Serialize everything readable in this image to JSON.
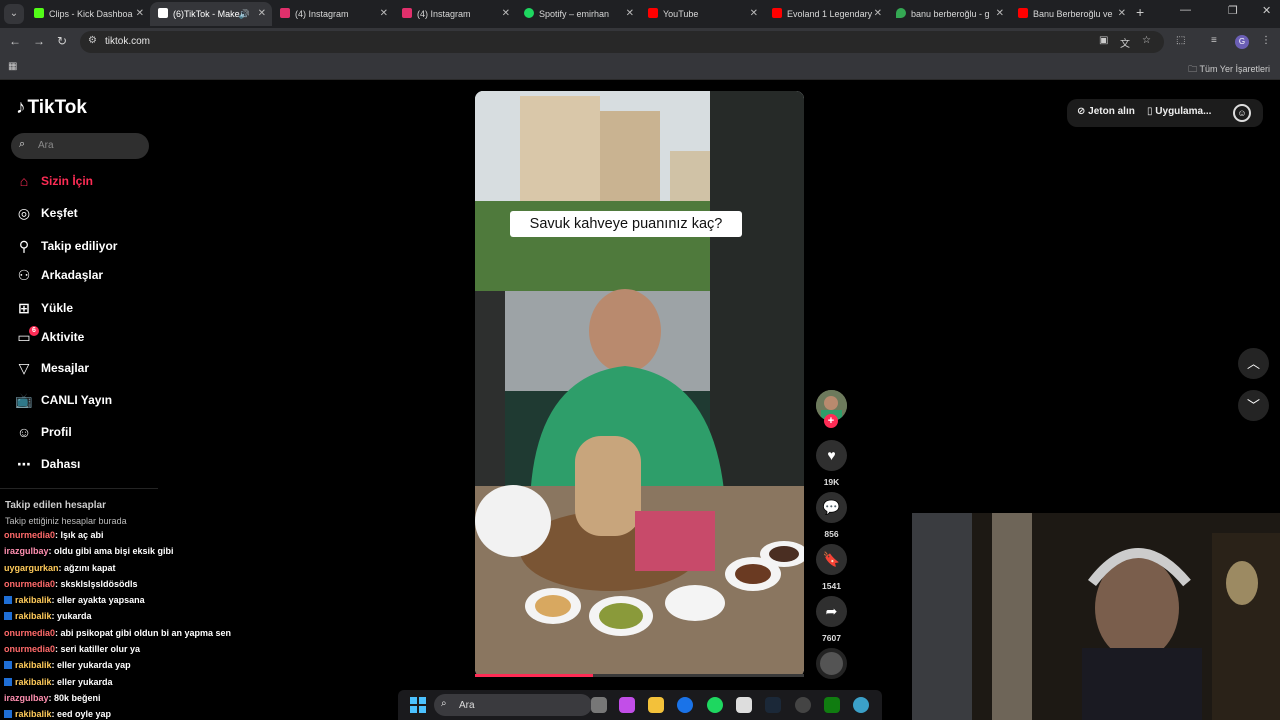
{
  "browser": {
    "tabs": [
      {
        "label": "Clips - Kick Dashboa",
        "color": "#53fc18",
        "active": false
      },
      {
        "label": "(6)TikTok - Make",
        "color": "#ffffff",
        "active": true
      },
      {
        "label": "(4) Instagram",
        "color": "#e1306c",
        "active": false
      },
      {
        "label": "(4) Instagram",
        "color": "#e1306c",
        "active": false
      },
      {
        "label": "Spotify – emirhan",
        "color": "#1ed760",
        "active": false
      },
      {
        "label": "YouTube",
        "color": "#ff0000",
        "active": false
      },
      {
        "label": "Evoland 1 Legendary",
        "color": "#ff0000",
        "active": false
      },
      {
        "label": "banu berberoğlu - g",
        "color": "#34a853",
        "active": false
      },
      {
        "label": "Banu Berberoğlu ve",
        "color": "#ff0000",
        "active": false
      }
    ],
    "url": "tiktok.com",
    "profile_initial": "G",
    "bookmarks_all_label": "Tüm Yer İşaretleri"
  },
  "sidebar": {
    "logo": "TikTok",
    "search_placeholder": "Ara",
    "items": [
      {
        "label": "Sizin İçin",
        "icon": "home-icon",
        "active": true
      },
      {
        "label": "Keşfet",
        "icon": "compass-icon",
        "active": false
      },
      {
        "label": "Takip ediliyor",
        "icon": "following-icon",
        "active": false
      },
      {
        "label": "Arkadaşlar",
        "icon": "friends-icon",
        "active": false
      },
      {
        "label": "Yükle",
        "icon": "upload-icon",
        "active": false
      },
      {
        "label": "Aktivite",
        "icon": "activity-icon",
        "active": false,
        "badge": "6"
      },
      {
        "label": "Mesajlar",
        "icon": "messages-icon",
        "active": false
      },
      {
        "label": "CANLI Yayın",
        "icon": "live-icon",
        "active": false
      },
      {
        "label": "Profil",
        "icon": "profile-icon",
        "active": false
      },
      {
        "label": "Dahası",
        "icon": "more-icon",
        "active": false
      }
    ],
    "following_title": "Takip edilen hesaplar",
    "following_sub": "Takip ettiğiniz hesaplar burada"
  },
  "chat": [
    {
      "user": "onurmedia0",
      "msg": ": Işık aç abi",
      "badge": false,
      "style": "u1"
    },
    {
      "user": "irazgulbay",
      "msg": ": oldu gibi ama bişi eksik gibi",
      "badge": false,
      "style": "u3"
    },
    {
      "user": "uygargurkan",
      "msg": ": ağzını kapat",
      "badge": false,
      "style": "u2"
    },
    {
      "user": "onurmedia0",
      "msg": ": sksklslşsldösödls",
      "badge": false,
      "style": "u1"
    },
    {
      "user": "rakibalik",
      "msg": ": eller ayakta yapsana",
      "badge": true,
      "style": "u2"
    },
    {
      "user": "rakibalik",
      "msg": ": yukarda",
      "badge": true,
      "style": "u2"
    },
    {
      "user": "onurmedia0",
      "msg": ": abi psikopat gibi oldun bi an yapma sen",
      "badge": false,
      "style": "u1"
    },
    {
      "user": "onurmedia0",
      "msg": ": seri katiller olur ya",
      "badge": false,
      "style": "u1"
    },
    {
      "user": "rakibalik",
      "msg": ": eller yukarda yap",
      "badge": true,
      "style": "u2"
    },
    {
      "user": "rakibalik",
      "msg": ": eller yukarda",
      "badge": true,
      "style": "u2"
    },
    {
      "user": "irazgulbay",
      "msg": ": 80k beğeni",
      "badge": false,
      "style": "u3"
    },
    {
      "user": "rakibalik",
      "msg": ": eed oyle yap",
      "badge": true,
      "style": "u2"
    }
  ],
  "video": {
    "caption": "Savuk kahveye puanınız kaç?",
    "progress": 0.36
  },
  "actions": {
    "likes": "19K",
    "comments": "856",
    "saves": "1541",
    "shares": "7607"
  },
  "topbar": {
    "coins_label": "Jeton alın",
    "app_label": "Uygulama..."
  },
  "taskbar": {
    "search_label": "Ara"
  }
}
